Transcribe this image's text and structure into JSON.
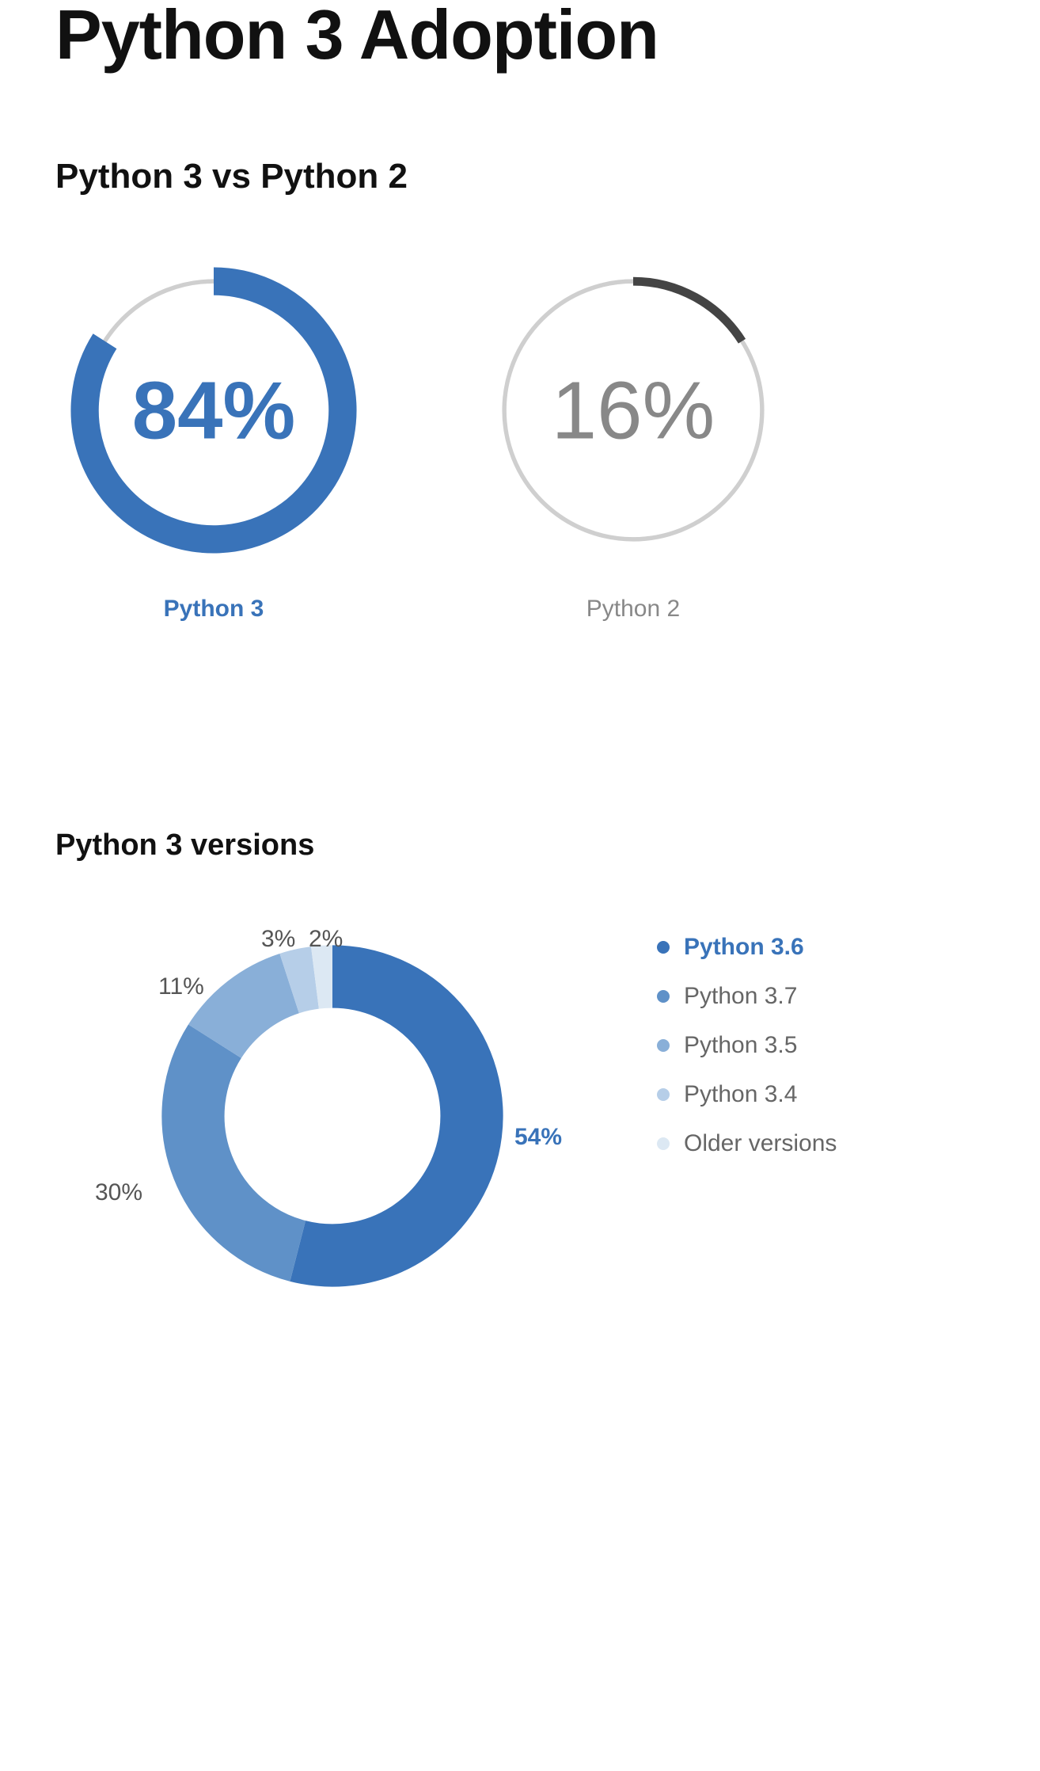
{
  "title": "Python 3 Adoption",
  "section1": {
    "heading": "Python 3 vs Python 2",
    "gauges": [
      {
        "label": "Python 3",
        "value": 84,
        "display": "84%",
        "color": "#3973B9",
        "track": "#CFCFCF",
        "primary": true
      },
      {
        "label": "Python 2",
        "value": 16,
        "display": "16%",
        "color": "#444444",
        "track": "#CFCFCF",
        "primary": false
      }
    ]
  },
  "section2": {
    "heading": "Python 3 versions",
    "slices": [
      {
        "label": "Python 3.6",
        "value": 54,
        "display": "54%",
        "color": "#3973B9",
        "highlight": true
      },
      {
        "label": "Python 3.7",
        "value": 30,
        "display": "30%",
        "color": "#5F91C8"
      },
      {
        "label": "Python 3.5",
        "value": 11,
        "display": "11%",
        "color": "#89AFD8"
      },
      {
        "label": "Python 3.4",
        "value": 3,
        "display": "3%",
        "color": "#B6CEE8"
      },
      {
        "label": "Older versions",
        "value": 2,
        "display": "2%",
        "color": "#DCE8F3"
      }
    ]
  },
  "chart_data": [
    {
      "type": "pie",
      "title": "Python 3 vs Python 2",
      "categories": [
        "Python 3",
        "Python 2"
      ],
      "values": [
        84,
        16
      ]
    },
    {
      "type": "pie",
      "title": "Python 3 versions",
      "categories": [
        "Python 3.6",
        "Python 3.7",
        "Python 3.5",
        "Python 3.4",
        "Older versions"
      ],
      "values": [
        54,
        30,
        11,
        3,
        2
      ]
    }
  ]
}
